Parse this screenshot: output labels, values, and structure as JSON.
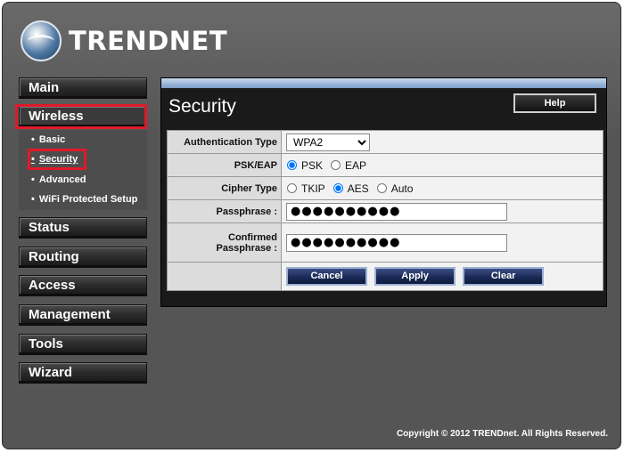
{
  "logo": {
    "text": "TRENDNET"
  },
  "sidebar": {
    "items": [
      {
        "label": "Main"
      },
      {
        "label": "Wireless"
      },
      {
        "label": "Status"
      },
      {
        "label": "Routing"
      },
      {
        "label": "Access"
      },
      {
        "label": "Management"
      },
      {
        "label": "Tools"
      },
      {
        "label": "Wizard"
      }
    ],
    "wireless_subitems": [
      {
        "label": "Basic"
      },
      {
        "label": "Security"
      },
      {
        "label": "Advanced"
      },
      {
        "label": "WiFi Protected Setup"
      }
    ]
  },
  "content": {
    "title": "Security",
    "help_label": "Help",
    "auth_type": {
      "label": "Authentication Type",
      "value": "WPA2"
    },
    "psk_eap": {
      "label": "PSK/EAP",
      "options": [
        "PSK",
        "EAP"
      ],
      "selected": "PSK"
    },
    "cipher_type": {
      "label": "Cipher Type",
      "options": [
        "TKIP",
        "AES",
        "Auto"
      ],
      "selected": "AES"
    },
    "passphrase": {
      "label": "Passphrase :",
      "value": "●●●●●●●●●●"
    },
    "confirmed_passphrase": {
      "label_line1": "Confirmed",
      "label_line2": "Passphrase :",
      "value": "●●●●●●●●●●"
    },
    "buttons": {
      "cancel": "Cancel",
      "apply": "Apply",
      "clear": "Clear"
    }
  },
  "footer": {
    "copyright": "Copyright © 2012 TRENDnet. All Rights Reserved."
  },
  "colors": {
    "highlight": "#e0192a",
    "panel_bg": "#555555",
    "accent_blue": "#1b2a56"
  }
}
